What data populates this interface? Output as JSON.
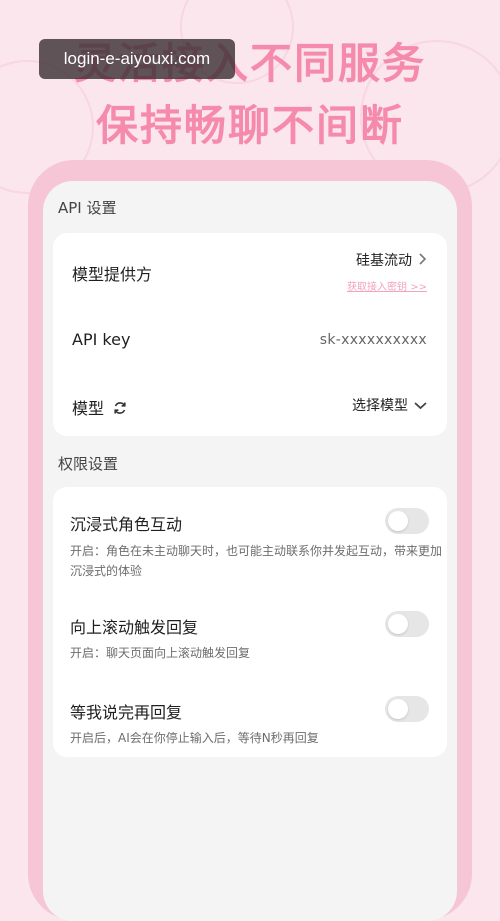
{
  "promo": {
    "line1": "灵活接入不同服务",
    "line2": "保持畅聊不间断"
  },
  "watermark": "login-e-aiyouxi.com",
  "api_section": {
    "title": "API 设置",
    "provider_label": "模型提供方",
    "provider_value": "硅基流动",
    "provider_link": "获取接入密钥 >>",
    "apikey_label": "API key",
    "apikey_value": "sk-xxxxxxxxxx",
    "model_label": "模型",
    "model_value": "选择模型"
  },
  "perm_section": {
    "title": "权限设置",
    "items": [
      {
        "label": "沉浸式角色互动",
        "desc": "开启：角色在未主动聊天时，也可能主动联系你并发起互动，带来更加沉浸式的体验",
        "enabled": false
      },
      {
        "label": "向上滚动触发回复",
        "desc": "开启：聊天页面向上滚动触发回复",
        "enabled": false
      },
      {
        "label": "等我说完再回复",
        "desc": "开启后，AI会在你停止输入后，等待N秒再回复",
        "enabled": false
      }
    ]
  },
  "colors": {
    "accent": "#f58aad",
    "frame": "#f7c6d6",
    "background": "#fbe6ee"
  }
}
